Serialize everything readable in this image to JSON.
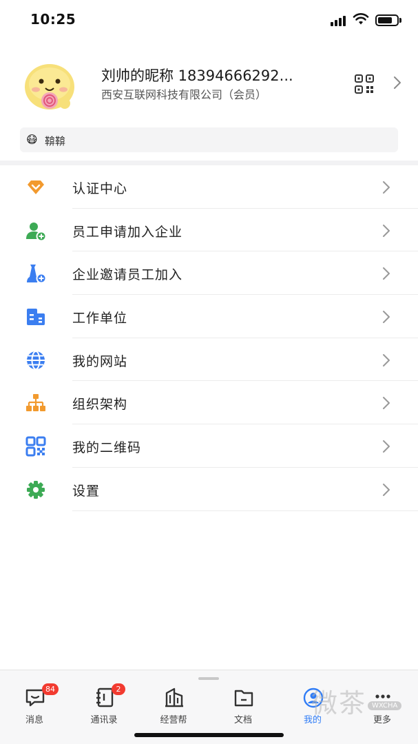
{
  "status_bar": {
    "time": "10:25"
  },
  "profile": {
    "name": "刘帅的昵称 18394666292...",
    "company": "西安互联网科技有限公司（会员）"
  },
  "tag": {
    "emoji": "😷",
    "text": "鞥鞥"
  },
  "menu": {
    "items": [
      {
        "label": "认证中心",
        "icon": "certified-diamond-icon",
        "color": "#f29a2e"
      },
      {
        "label": "员工申请加入企业",
        "icon": "user-add-icon",
        "color": "#3daa55"
      },
      {
        "label": "企业邀请员工加入",
        "icon": "staff-invite-icon",
        "color": "#3b7ef0"
      },
      {
        "label": "工作单位",
        "icon": "building-icon",
        "color": "#3b7ef0"
      },
      {
        "label": "我的网站",
        "icon": "globe-icon",
        "color": "#3b7ef0"
      },
      {
        "label": "组织架构",
        "icon": "org-chart-icon",
        "color": "#f29a2e"
      },
      {
        "label": "我的二维码",
        "icon": "qrcode-icon",
        "color": "#3b7ef0"
      },
      {
        "label": "设置",
        "icon": "gear-icon",
        "color": "#3daa55"
      }
    ]
  },
  "tabbar": {
    "tabs": [
      {
        "label": "消息",
        "badge": "84",
        "icon": "message-icon"
      },
      {
        "label": "通讯录",
        "badge": "2",
        "icon": "contacts-icon"
      },
      {
        "label": "经营帮",
        "icon": "business-icon"
      },
      {
        "label": "文档",
        "icon": "folder-icon"
      },
      {
        "label": "我的",
        "icon": "profile-icon",
        "active": true
      },
      {
        "label": "更多",
        "icon": "more-icon"
      }
    ],
    "active_color": "#2f7cf6"
  },
  "watermark": {
    "text": "微茶",
    "sub": "WXCHA"
  }
}
